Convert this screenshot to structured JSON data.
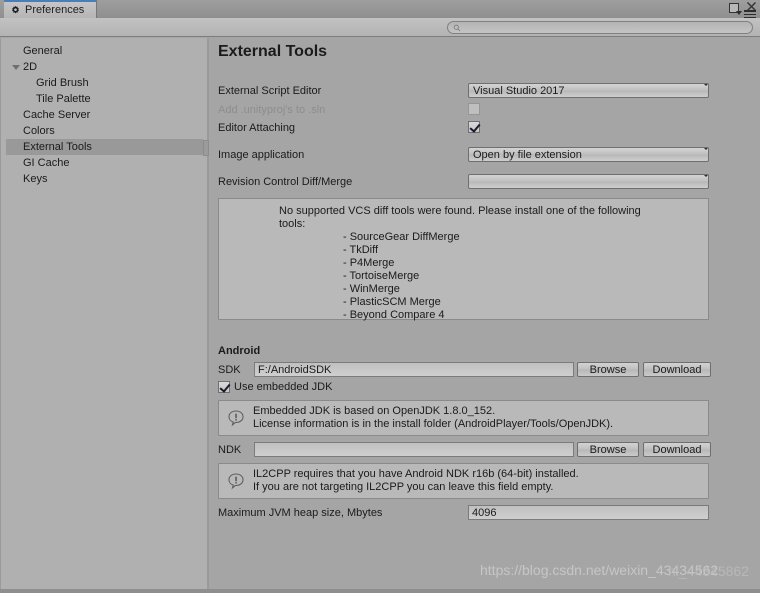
{
  "window": {
    "tab_label": "Preferences",
    "tab_icon": "gear-icon",
    "maximize_label": "",
    "close_label": "",
    "menu_label": ""
  },
  "search": {
    "value": "",
    "placeholder": "",
    "icon": "search-icon"
  },
  "sidebar": {
    "items": [
      {
        "label": "General",
        "indent": 0,
        "twisty": false,
        "selected": false
      },
      {
        "label": "2D",
        "indent": 0,
        "twisty": true,
        "selected": false
      },
      {
        "label": "Grid Brush",
        "indent": 1,
        "twisty": false,
        "selected": false
      },
      {
        "label": "Tile Palette",
        "indent": 1,
        "twisty": false,
        "selected": false
      },
      {
        "label": "Cache Server",
        "indent": 0,
        "twisty": false,
        "selected": false
      },
      {
        "label": "Colors",
        "indent": 0,
        "twisty": false,
        "selected": false
      },
      {
        "label": "External Tools",
        "indent": 0,
        "twisty": false,
        "selected": true
      },
      {
        "label": "GI Cache",
        "indent": 0,
        "twisty": false,
        "selected": false
      },
      {
        "label": "Keys",
        "indent": 0,
        "twisty": false,
        "selected": false
      }
    ]
  },
  "main": {
    "title": "External Tools",
    "external_script_editor": {
      "label": "External Script Editor",
      "value": "Visual Studio 2017"
    },
    "add_unityproj": {
      "label": "Add .unityproj's to .sln",
      "checked": false,
      "disabled": true
    },
    "editor_attaching": {
      "label": "Editor Attaching",
      "checked": true,
      "disabled": false
    },
    "image_application": {
      "label": "Image application",
      "value": "Open by file extension"
    },
    "revision_control": {
      "label": "Revision Control Diff/Merge",
      "value": ""
    },
    "vcs_helpbox": {
      "line1": "No supported VCS diff tools were found. Please install one of the following",
      "line2": "tools:",
      "tools": [
        "- SourceGear DiffMerge",
        "- TkDiff",
        "- P4Merge",
        "- TortoiseMerge",
        "- WinMerge",
        "- PlasticSCM Merge",
        "- Beyond Compare 4"
      ]
    },
    "android": {
      "section_label": "Android",
      "sdk": {
        "label": "SDK",
        "value": "F:/AndroidSDK",
        "browse_label": "Browse",
        "download_label": "Download"
      },
      "use_embedded_jdk": {
        "label": "Use embedded JDK",
        "checked": true
      },
      "jdk_helpbox": {
        "icon": "info-icon",
        "line1": "Embedded JDK is based on OpenJDK 1.8.0_152.",
        "line2": "License information is in the install folder (AndroidPlayer/Tools/OpenJDK)."
      },
      "ndk": {
        "label": "NDK",
        "value": "",
        "browse_label": "Browse",
        "download_label": "Download"
      },
      "ndk_helpbox": {
        "icon": "info-icon",
        "line1": "IL2CPP requires that you have Android NDK r16b (64-bit) installed.",
        "line2": "If you are not targeting IL2CPP you can leave this field empty."
      },
      "jvm_heap": {
        "label": "Maximum JVM heap size, Mbytes",
        "value": "4096"
      }
    }
  },
  "watermark": {
    "text": "https://blog.csdn.net/weixin_43434562",
    "overlay": "hi_44345862"
  },
  "colors": {
    "window_bg": "#a5a5a5",
    "sidebar_bg": "#b0b0b0",
    "selection": "#999999",
    "tab_accent": "#4a7ebb",
    "helpbox_bg": "#b9b9b9",
    "text": "#1b1b1b",
    "disabled_text": "#8d8d8d"
  }
}
